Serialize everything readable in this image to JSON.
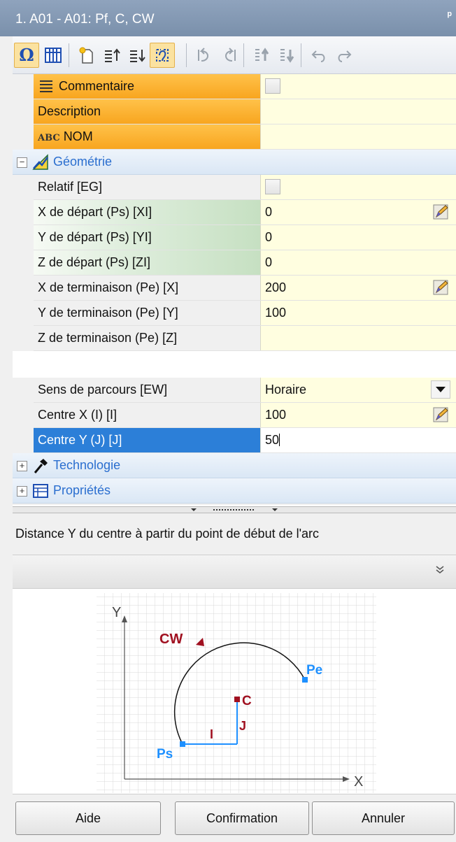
{
  "window": {
    "title": "1. A01 - A01: Pf, C, CW",
    "pin_glyph": "ᵖ"
  },
  "toolbar": {
    "buttons": [
      "omega-icon",
      "grid-icon",
      "new-item-icon",
      "move-up-icon",
      "move-down-icon",
      "select-path-icon",
      "rotate-left-icon",
      "rotate-right-icon",
      "sort-up-icon",
      "sort-down-icon",
      "undo-icon",
      "redo-icon"
    ]
  },
  "properties": {
    "commentaire": {
      "label": "Commentaire"
    },
    "description": {
      "label": "Description",
      "value": ""
    },
    "nom": {
      "prefix": "ABC",
      "label": "NOM",
      "value": ""
    },
    "geometrie": {
      "label": "Géométrie"
    },
    "relatif": {
      "label": "Relatif [EG]"
    },
    "x_depart": {
      "label": "X de départ (Ps) [XI]",
      "value": "0"
    },
    "y_depart": {
      "label": "Y de départ (Ps) [YI]",
      "value": "0"
    },
    "z_depart": {
      "label": "Z de départ (Ps) [ZI]",
      "value": "0"
    },
    "x_term": {
      "label": "X de terminaison (Pe) [X]",
      "value": "200"
    },
    "y_term": {
      "label": "Y de terminaison (Pe) [Y]",
      "value": "100"
    },
    "z_term": {
      "label": "Z de terminaison (Pe) [Z]",
      "value": ""
    },
    "sens": {
      "label": "Sens de parcours [EW]",
      "value": "Horaire"
    },
    "centre_x": {
      "label": "Centre X (I) [I]",
      "value": "100"
    },
    "centre_y": {
      "label": "Centre Y (J) [J]",
      "value": "50"
    },
    "technologie": {
      "label": "Technologie"
    },
    "proprietes": {
      "label": "Propriétés"
    }
  },
  "help": {
    "description": "Distance Y du centre à partir du point de début de l'arc"
  },
  "diagram": {
    "y_axis": "Y",
    "x_axis": "X",
    "direction": "CW",
    "start": "Ps",
    "end": "Pe",
    "center": "C",
    "i_label": "I",
    "j_label": "J"
  },
  "buttons": {
    "help": "Aide",
    "confirm": "Confirmation",
    "cancel": "Annuler"
  },
  "colors": {
    "title_bg": "#7a90ab",
    "highlight": "#2c7fd8",
    "orange_label": "#f8a51f",
    "value_bg": "#fffee0",
    "diagram_blue": "#1e90ff",
    "diagram_red": "#a01020"
  }
}
